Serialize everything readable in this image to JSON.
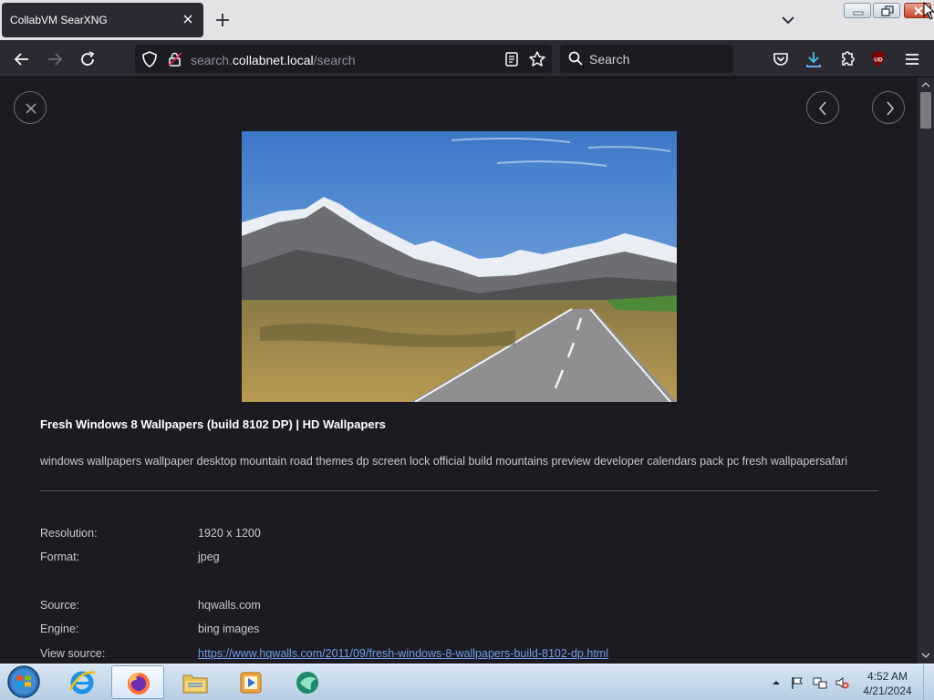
{
  "browser": {
    "tab": {
      "title": "CollabVM SearXNG"
    },
    "url": {
      "prefix": "search.",
      "domain": "collabnet.local",
      "path": "/search"
    },
    "search": {
      "placeholder": "Search"
    }
  },
  "result": {
    "title": "Fresh Windows 8 Wallpapers (build 8102 DP) | HD Wallpapers",
    "tags": "windows wallpapers wallpaper desktop mountain road themes dp screen lock official build mountains preview developer calendars pack pc fresh wallpapersafari",
    "details": [
      {
        "label": "Resolution:",
        "value": "1920 x 1200"
      },
      {
        "label": "Format:",
        "value": "jpeg"
      },
      {
        "label": "Source:",
        "value": "hqwalls.com"
      },
      {
        "label": "Engine:",
        "value": "bing images"
      },
      {
        "label": "View source:",
        "value": "https://www.hqwalls.com/2011/09/fresh-windows-8-wallpapers-build-8102-dp.html"
      }
    ]
  },
  "taskbar": {
    "time": "4:52 AM",
    "date": "4/21/2024",
    "apps": [
      "internet-explorer-icon",
      "firefox-icon",
      "file-explorer-icon",
      "media-player-icon",
      "app-icon"
    ]
  },
  "colors": {
    "accent_link": "#6d9eea",
    "page_bg": "#1c1b22",
    "toolbar_bg": "#2b2a33"
  }
}
